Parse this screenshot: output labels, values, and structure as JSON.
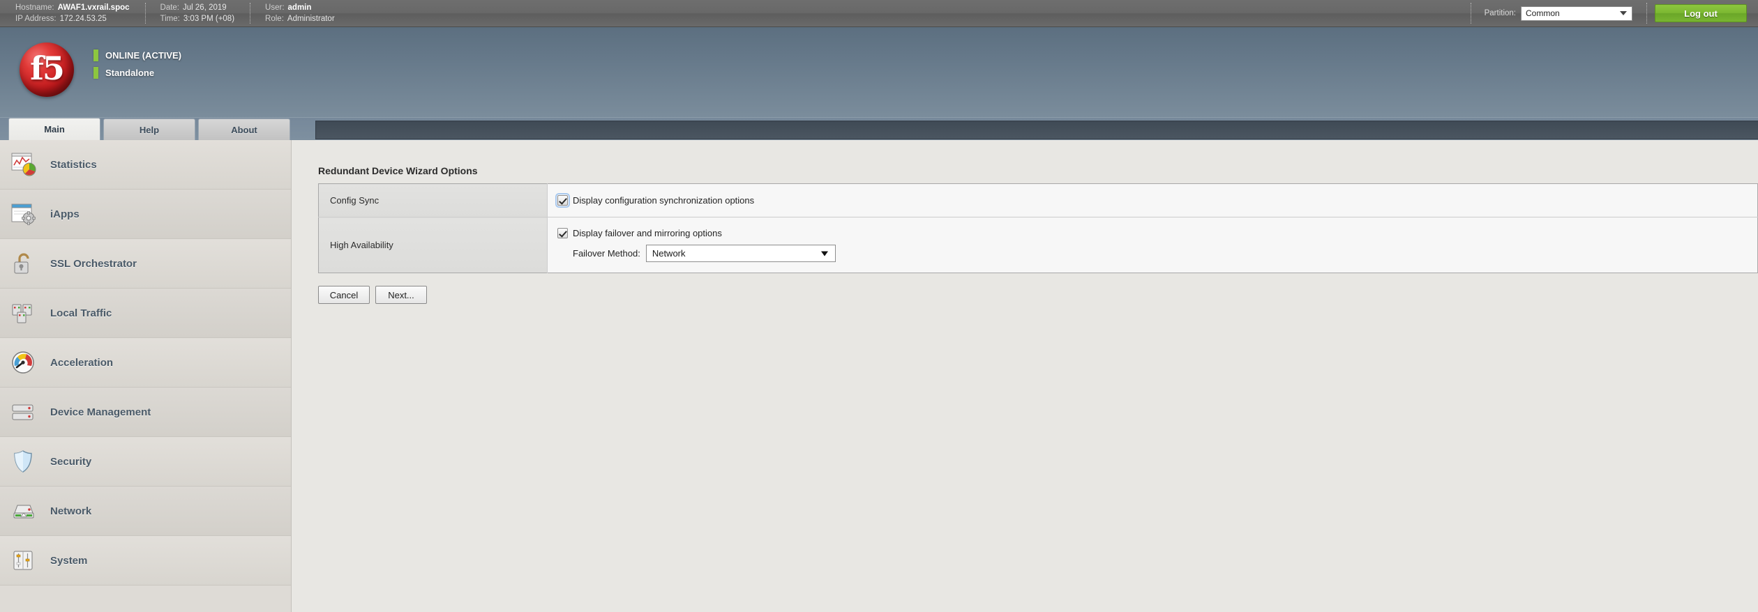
{
  "topbar": {
    "groups": [
      {
        "rows": [
          {
            "key": "Hostname:",
            "value": "AWAF1.vxrail.spoc",
            "bold": true
          },
          {
            "key": "IP Address:",
            "value": "172.24.53.25",
            "bold": false
          }
        ]
      },
      {
        "rows": [
          {
            "key": "Date:",
            "value": "Jul 26, 2019",
            "bold": false
          },
          {
            "key": "Time:",
            "value": "3:03 PM (+08)",
            "bold": false
          }
        ]
      },
      {
        "rows": [
          {
            "key": "User:",
            "value": "admin",
            "bold": true
          },
          {
            "key": "Role:",
            "value": "Administrator",
            "bold": false
          }
        ]
      }
    ],
    "partition_label": "Partition:",
    "partition_value": "Common",
    "logout_label": "Log out"
  },
  "banner": {
    "logo_text": "f5",
    "status_primary": "ONLINE (ACTIVE)",
    "status_secondary": "Standalone",
    "status_color": "#8dc63f"
  },
  "tabs": [
    {
      "label": "Main",
      "active": true
    },
    {
      "label": "Help",
      "active": false
    },
    {
      "label": "About",
      "active": false
    }
  ],
  "sidebar": {
    "items": [
      {
        "label": "Statistics",
        "icon": "chart-pie-icon"
      },
      {
        "label": "iApps",
        "icon": "window-gear-icon"
      },
      {
        "label": "SSL Orchestrator",
        "icon": "open-padlock-icon"
      },
      {
        "label": "Local Traffic",
        "icon": "servers-group-icon"
      },
      {
        "label": "Acceleration",
        "icon": "speedometer-icon"
      },
      {
        "label": "Device Management",
        "icon": "stacked-devices-icon"
      },
      {
        "label": "Security",
        "icon": "shield-icon"
      },
      {
        "label": "Network",
        "icon": "network-device-icon"
      },
      {
        "label": "System",
        "icon": "sliders-icon"
      }
    ]
  },
  "main": {
    "panel_title": "Redundant Device Wizard Options",
    "rows": [
      {
        "label": "Config Sync",
        "checkbox_label": "Display configuration synchronization options",
        "checked": true,
        "focused": true
      },
      {
        "label": "High Availability",
        "checkbox_label": "Display failover and mirroring options",
        "checked": true,
        "focused": false,
        "failover_method_label": "Failover Method:",
        "failover_method_value": "Network"
      }
    ],
    "buttons": [
      {
        "label": "Cancel",
        "name": "cancel-button"
      },
      {
        "label": "Next...",
        "name": "next-button"
      }
    ]
  }
}
